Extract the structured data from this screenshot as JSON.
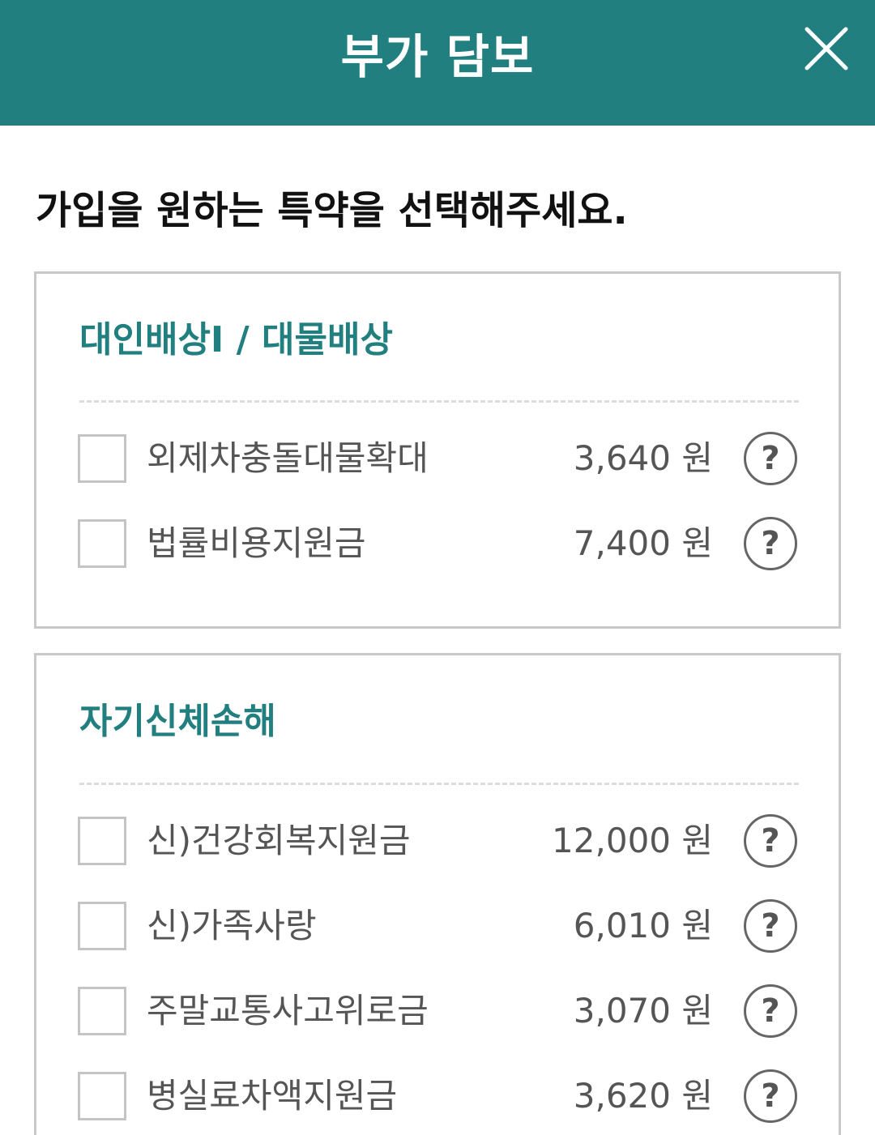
{
  "header": {
    "title": "부가 담보",
    "close_icon": "close-icon",
    "background_color": "#227f7f"
  },
  "instruction": "가입을 원하는 특약을 선택해주세요.",
  "sections": [
    {
      "title": "대인배상Ⅰ / 대물배상",
      "items": [
        {
          "label": "외제차충돌대물확대",
          "price": "3,640 원",
          "checked": false,
          "help_icon": "question-icon"
        },
        {
          "label": "법률비용지원금",
          "price": "7,400 원",
          "checked": false,
          "help_icon": "question-icon"
        }
      ]
    },
    {
      "title": "자기신체손해",
      "items": [
        {
          "label": "신)건강회복지원금",
          "price": "12,000 원",
          "checked": false,
          "help_icon": "question-icon"
        },
        {
          "label": "신)가족사랑",
          "price": "6,010 원",
          "checked": false,
          "help_icon": "question-icon"
        },
        {
          "label": "주말교통사고위로금",
          "price": "3,070 원",
          "checked": false,
          "help_icon": "question-icon"
        },
        {
          "label": "병실료차액지원금",
          "price": "3,620 원",
          "checked": false,
          "help_icon": "question-icon"
        }
      ]
    }
  ],
  "help_symbol": "?",
  "accent_color": "#227f7f"
}
